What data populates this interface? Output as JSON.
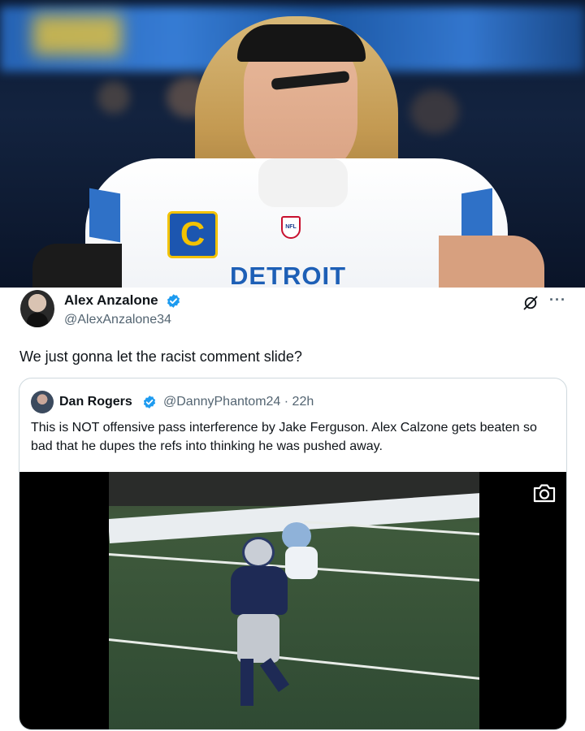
{
  "hero": {
    "jersey_wordmark": "DETROIT",
    "captain_patch_letter": "C",
    "nfl_shield_text": "NFL"
  },
  "tweet": {
    "author": {
      "name": "Alex Anzalone",
      "handle": "@AlexAnzalone34",
      "verified": true
    },
    "text": "We just gonna let the racist comment slide?",
    "icons": [
      "grok-icon",
      "more-options-icon"
    ],
    "more_label": "···"
  },
  "quoted_tweet": {
    "author": {
      "name": "Dan Rogers",
      "handle_time": "@DannyPhantom24 · 22h",
      "verified": true
    },
    "text": "This is NOT offensive pass interference by Jake Ferguson. Alex Calzone gets beaten so bad that he dupes the refs into thinking he was pushed away.",
    "media": {
      "type": "video-still",
      "icon": "camera-icon"
    }
  },
  "colors": {
    "verified_blue": "#1d9bf0",
    "text_primary": "#0f1419",
    "text_secondary": "#536471",
    "lions_blue": "#1d5fb6"
  }
}
